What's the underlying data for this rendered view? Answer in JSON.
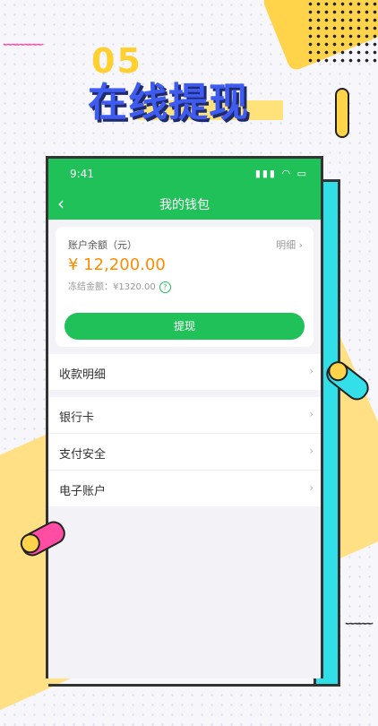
{
  "promo": {
    "number": "05",
    "title": "在线提现"
  },
  "status_bar": {
    "time": "9:41",
    "icons": "signal wifi battery"
  },
  "nav": {
    "back_icon": "‹",
    "title": "我的钱包"
  },
  "wallet": {
    "balance_label": "账户余额（元）",
    "detail_link": "明细",
    "balance_amount": "¥ 12,200.00",
    "frozen_text": "冻结金额：¥1320.00",
    "withdraw_button": "提现"
  },
  "menu_groups": [
    [
      {
        "label": "收款明细"
      }
    ],
    [
      {
        "label": "银行卡"
      },
      {
        "label": "支付安全"
      },
      {
        "label": "电子账户"
      }
    ]
  ],
  "colors": {
    "brand_green": "#21c15a",
    "amount_orange": "#ff8c00",
    "accent_blue": "#3e5bf2",
    "accent_yellow": "#ffd34a",
    "accent_cyan": "#31dfe9",
    "accent_pink": "#ff4da3"
  }
}
